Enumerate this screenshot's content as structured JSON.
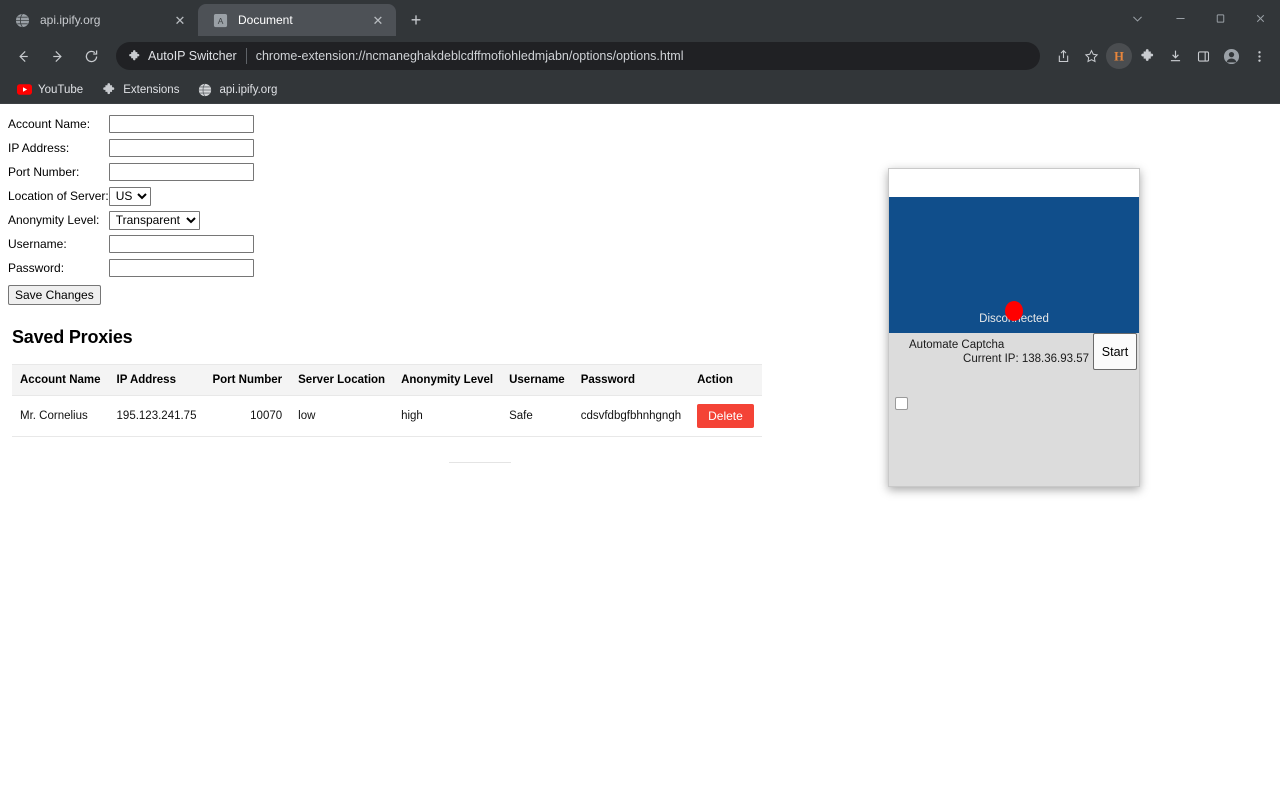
{
  "browser": {
    "tabs": [
      {
        "title": "api.ipify.org",
        "favicon": "globe-icon",
        "active": false,
        "close_label": "✕"
      },
      {
        "title": "Document",
        "favicon": "doc-letter-icon",
        "active": true,
        "close_label": "✕"
      }
    ],
    "new_tab_label": "+",
    "window_controls": {
      "tab_search": "⌄",
      "minimize": "—",
      "maximize": "❐",
      "close": "✕"
    },
    "nav": {
      "back": "←",
      "forward": "→",
      "reload": "↻"
    },
    "omnibox": {
      "extension_name": "AutoIP Switcher",
      "separator": "|",
      "url": "chrome-extension://ncmaneghakdeblcdffmofiohledmjabn/options/options.html"
    },
    "toolbar_icons": [
      {
        "name": "share-icon",
        "glyph": "➦"
      },
      {
        "name": "bookmark-star-icon",
        "glyph": "☆"
      },
      {
        "name": "autoip-switcher-extension-icon",
        "glyph": "H",
        "highlighted": true
      },
      {
        "name": "extensions-puzzle-icon",
        "glyph": "❖"
      },
      {
        "name": "downloads-icon",
        "glyph": "⬇"
      },
      {
        "name": "side-panel-icon",
        "glyph": "▣"
      },
      {
        "name": "profile-avatar-icon",
        "glyph": "●"
      },
      {
        "name": "chrome-menu-icon",
        "glyph": "⋮"
      }
    ],
    "bookmarks": [
      {
        "label": "YouTube",
        "icon": "youtube-icon"
      },
      {
        "label": "Extensions",
        "icon": "puzzle-icon"
      },
      {
        "label": "api.ipify.org",
        "icon": "globe-icon"
      }
    ]
  },
  "page": {
    "form": {
      "fields": [
        {
          "label": "Account Name:",
          "type": "text",
          "value": "",
          "placeholder": ""
        },
        {
          "label": "IP Address:",
          "type": "text",
          "value": "",
          "placeholder": ""
        },
        {
          "label": "Port Number:",
          "type": "text",
          "value": "",
          "placeholder": ""
        }
      ],
      "location_label": "Location of Server:",
      "location_value": "US",
      "location_options": [
        "US"
      ],
      "anonymity_label": "Anonymity Level:",
      "anonymity_value": "Transparent",
      "anonymity_options": [
        "Transparent"
      ],
      "username_label": "Username:",
      "username_value": "",
      "password_label": "Password:",
      "password_value": "",
      "save_button": "Save Changes"
    },
    "saved_proxies": {
      "title": "Saved Proxies",
      "columns": [
        "Account Name",
        "IP Address",
        "Port Number",
        "Server Location",
        "Anonymity Level",
        "Username",
        "Password",
        "Action"
      ],
      "rows": [
        {
          "account_name": "Mr. Cornelius",
          "ip_address": "195.123.241.75",
          "port_number": "10070",
          "server_location": "low",
          "anonymity_level": "high",
          "username": "Safe",
          "password": "cdsvfdbgfbhnhgngh",
          "action": "Delete"
        }
      ]
    }
  },
  "popup": {
    "status_text": "Disconnected",
    "status_color": "#ff0000",
    "hero_color": "#104e8b",
    "captcha_label": "Automate Captcha",
    "current_ip_label": "Current IP: 138.36.93.57",
    "start_button": "Start",
    "checkbox_checked": false
  }
}
